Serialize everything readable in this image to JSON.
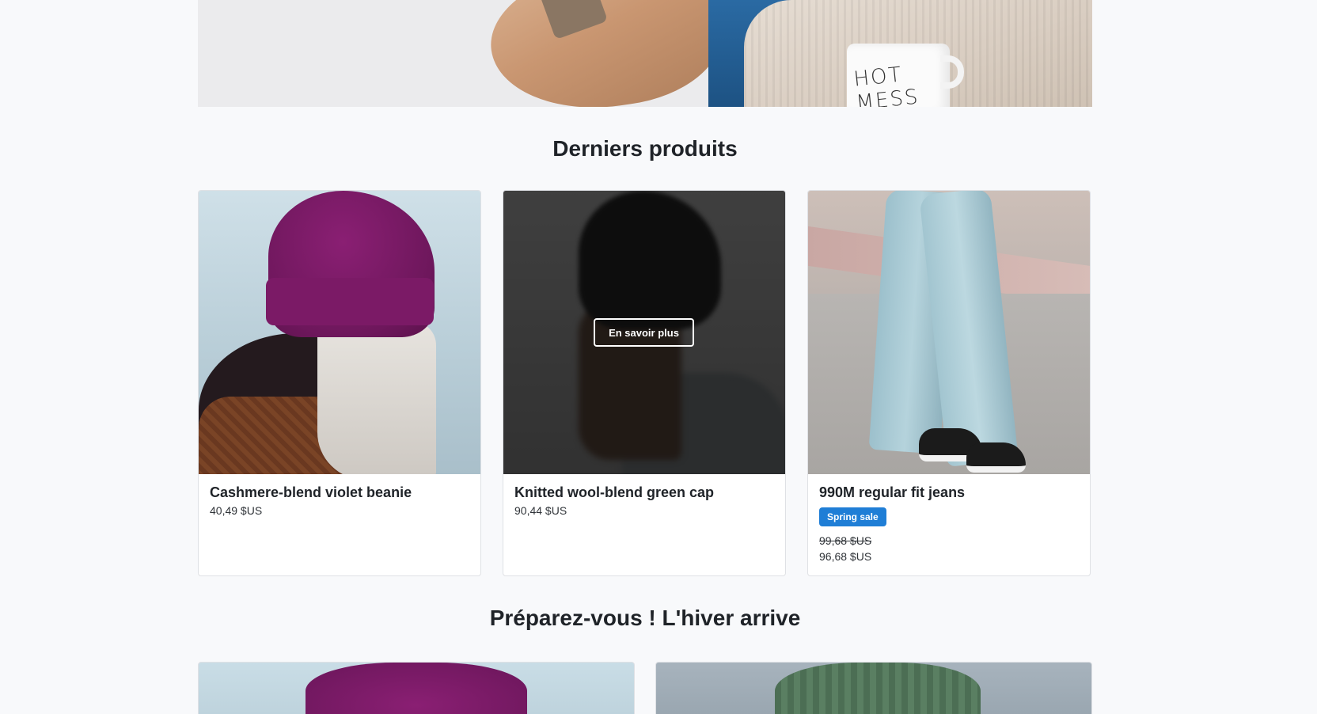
{
  "sections": {
    "latest_title": "Derniers produits",
    "winter_title": "Préparez-vous ! L'hiver arrive"
  },
  "hero": {
    "mug_text": "HOT MESS"
  },
  "products": [
    {
      "name": "Cashmere-blend violet beanie",
      "price": "40,49 $US"
    },
    {
      "name": "Knitted wool-blend green cap",
      "price": "90,44 $US",
      "hover_button": "En savoir plus"
    },
    {
      "name": "990M regular fit jeans",
      "badge": "Spring sale",
      "old_price": "99,68 $US",
      "price": "96,68 $US"
    }
  ],
  "colors": {
    "page_background": "#f8f9fb",
    "badge": "#1f7ed6",
    "text": "#1f2328"
  }
}
